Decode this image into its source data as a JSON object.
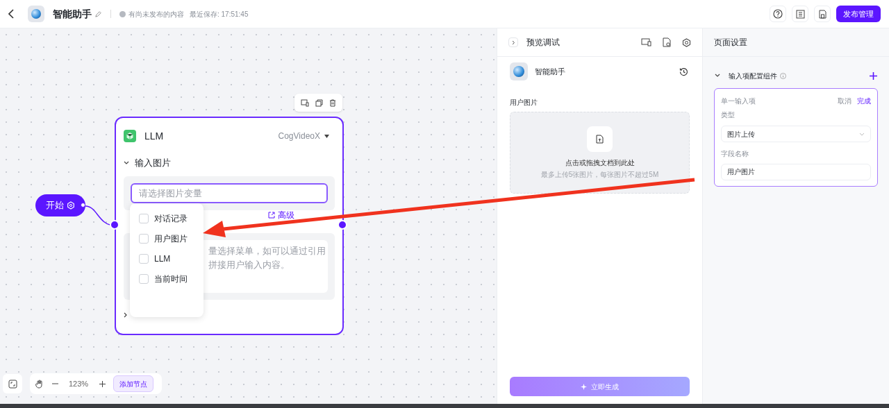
{
  "header": {
    "title": "智能助手",
    "status": "有尚未发布的内容",
    "saved": "最近保存: 17:51:45",
    "publish_button": "发布管理"
  },
  "canvas": {
    "start_node": "开始",
    "llm_node": {
      "title": "LLM",
      "model": "CogVideoX",
      "input_section": {
        "title": "输入图片",
        "expanded": true,
        "placeholder": "请选择图片变量"
      },
      "advanced_link": "高级",
      "prompt_lines": [
        "量选择菜单，如可以通过引用",
        "拼接用户输入内容。"
      ]
    },
    "variable_menu": [
      {
        "label": "对话记录",
        "checked": false
      },
      {
        "label": "用户图片",
        "checked": false
      },
      {
        "label": "LLM",
        "checked": false
      },
      {
        "label": "当前时间",
        "checked": false
      }
    ],
    "zoom": "123%",
    "add_node_button": "添加节点"
  },
  "preview": {
    "title": "预览调试",
    "app_name": "智能助手",
    "field_label": "用户图片",
    "upload_title": "点击或拖拽文档到此处",
    "upload_hint": "最多上传5张图片，每张图片不超过5M",
    "generate_button": "立即生成"
  },
  "settings": {
    "title": "页面设置",
    "section": {
      "title": "输入项配置组件",
      "expanded": true
    },
    "item": {
      "title": "单一输入项",
      "cancel": "取消",
      "done": "完成",
      "type_label": "类型",
      "type_value": "图片上传",
      "name_label": "字段名称",
      "name_value": "用户图片"
    }
  }
}
